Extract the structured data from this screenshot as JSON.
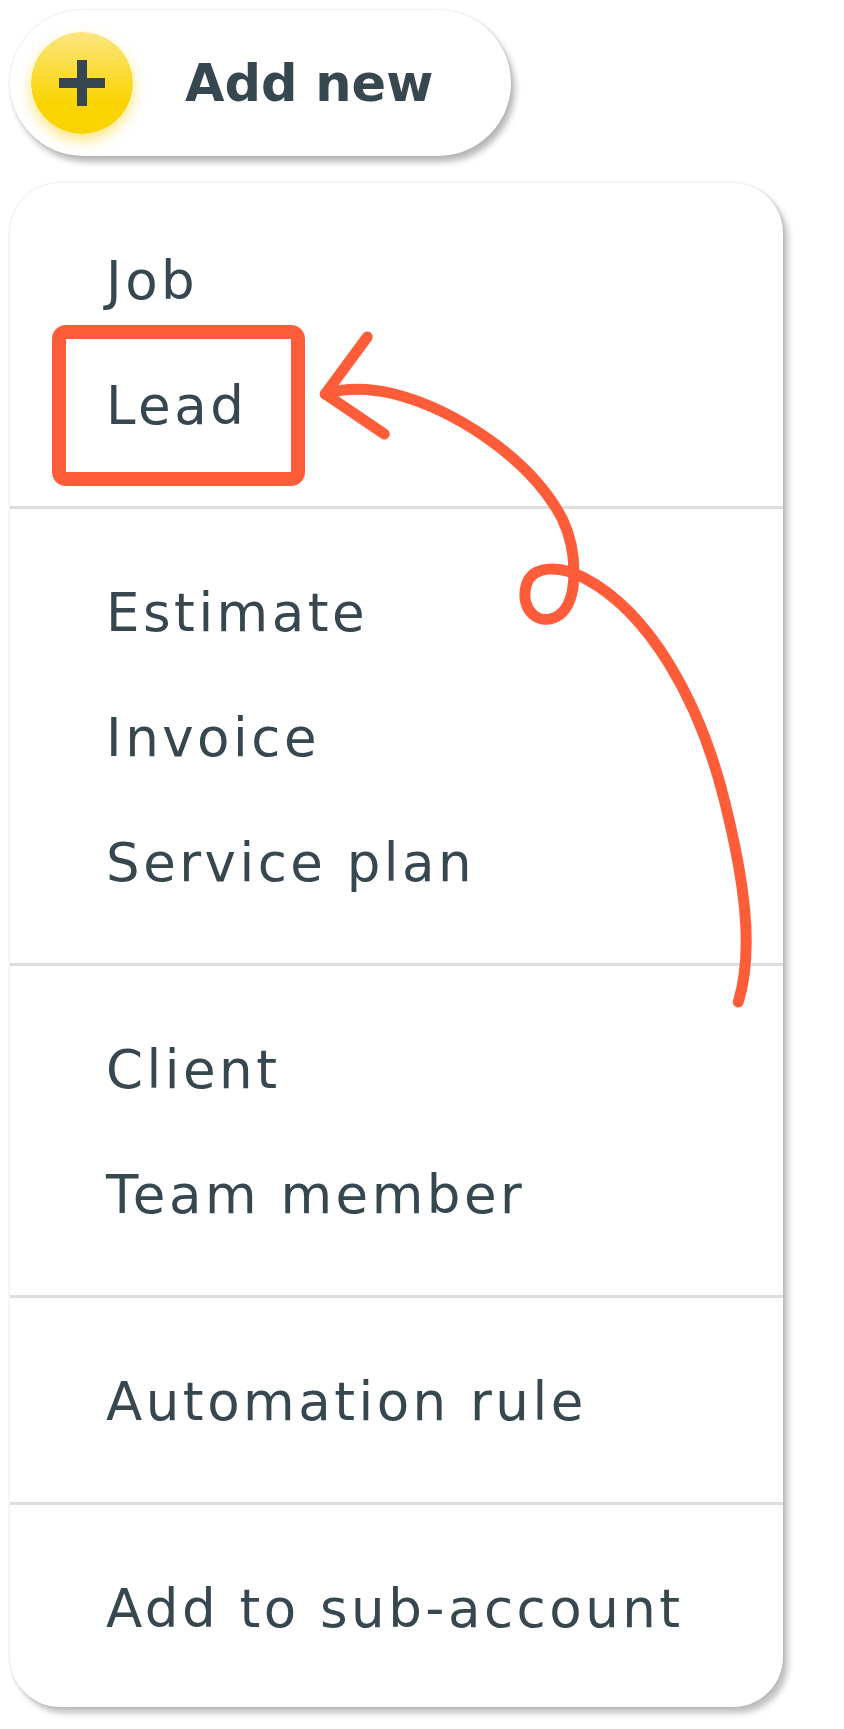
{
  "add_button": {
    "label": "Add new"
  },
  "menu": {
    "sections": [
      {
        "items": [
          {
            "label": "Job",
            "highlighted": false
          },
          {
            "label": "Lead",
            "highlighted": true
          }
        ]
      },
      {
        "items": [
          {
            "label": "Estimate",
            "highlighted": false
          },
          {
            "label": "Invoice",
            "highlighted": false
          },
          {
            "label": "Service plan",
            "highlighted": false
          }
        ]
      },
      {
        "items": [
          {
            "label": "Client",
            "highlighted": false
          },
          {
            "label": "Team member",
            "highlighted": false
          }
        ]
      },
      {
        "items": [
          {
            "label": "Automation rule",
            "highlighted": false
          }
        ]
      },
      {
        "items": [
          {
            "label": "Add to sub-account",
            "highlighted": false
          }
        ]
      }
    ]
  }
}
